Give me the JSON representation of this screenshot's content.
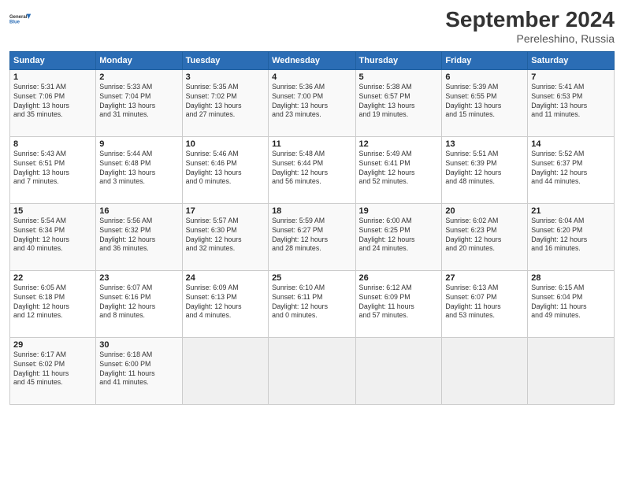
{
  "header": {
    "logo_line1": "General",
    "logo_line2": "Blue",
    "month": "September 2024",
    "location": "Pereleshino, Russia"
  },
  "weekdays": [
    "Sunday",
    "Monday",
    "Tuesday",
    "Wednesday",
    "Thursday",
    "Friday",
    "Saturday"
  ],
  "rows": [
    [
      {
        "day": "1",
        "info": "Sunrise: 5:31 AM\nSunset: 7:06 PM\nDaylight: 13 hours\nand 35 minutes."
      },
      {
        "day": "2",
        "info": "Sunrise: 5:33 AM\nSunset: 7:04 PM\nDaylight: 13 hours\nand 31 minutes."
      },
      {
        "day": "3",
        "info": "Sunrise: 5:35 AM\nSunset: 7:02 PM\nDaylight: 13 hours\nand 27 minutes."
      },
      {
        "day": "4",
        "info": "Sunrise: 5:36 AM\nSunset: 7:00 PM\nDaylight: 13 hours\nand 23 minutes."
      },
      {
        "day": "5",
        "info": "Sunrise: 5:38 AM\nSunset: 6:57 PM\nDaylight: 13 hours\nand 19 minutes."
      },
      {
        "day": "6",
        "info": "Sunrise: 5:39 AM\nSunset: 6:55 PM\nDaylight: 13 hours\nand 15 minutes."
      },
      {
        "day": "7",
        "info": "Sunrise: 5:41 AM\nSunset: 6:53 PM\nDaylight: 13 hours\nand 11 minutes."
      }
    ],
    [
      {
        "day": "8",
        "info": "Sunrise: 5:43 AM\nSunset: 6:51 PM\nDaylight: 13 hours\nand 7 minutes."
      },
      {
        "day": "9",
        "info": "Sunrise: 5:44 AM\nSunset: 6:48 PM\nDaylight: 13 hours\nand 3 minutes."
      },
      {
        "day": "10",
        "info": "Sunrise: 5:46 AM\nSunset: 6:46 PM\nDaylight: 13 hours\nand 0 minutes."
      },
      {
        "day": "11",
        "info": "Sunrise: 5:48 AM\nSunset: 6:44 PM\nDaylight: 12 hours\nand 56 minutes."
      },
      {
        "day": "12",
        "info": "Sunrise: 5:49 AM\nSunset: 6:41 PM\nDaylight: 12 hours\nand 52 minutes."
      },
      {
        "day": "13",
        "info": "Sunrise: 5:51 AM\nSunset: 6:39 PM\nDaylight: 12 hours\nand 48 minutes."
      },
      {
        "day": "14",
        "info": "Sunrise: 5:52 AM\nSunset: 6:37 PM\nDaylight: 12 hours\nand 44 minutes."
      }
    ],
    [
      {
        "day": "15",
        "info": "Sunrise: 5:54 AM\nSunset: 6:34 PM\nDaylight: 12 hours\nand 40 minutes."
      },
      {
        "day": "16",
        "info": "Sunrise: 5:56 AM\nSunset: 6:32 PM\nDaylight: 12 hours\nand 36 minutes."
      },
      {
        "day": "17",
        "info": "Sunrise: 5:57 AM\nSunset: 6:30 PM\nDaylight: 12 hours\nand 32 minutes."
      },
      {
        "day": "18",
        "info": "Sunrise: 5:59 AM\nSunset: 6:27 PM\nDaylight: 12 hours\nand 28 minutes."
      },
      {
        "day": "19",
        "info": "Sunrise: 6:00 AM\nSunset: 6:25 PM\nDaylight: 12 hours\nand 24 minutes."
      },
      {
        "day": "20",
        "info": "Sunrise: 6:02 AM\nSunset: 6:23 PM\nDaylight: 12 hours\nand 20 minutes."
      },
      {
        "day": "21",
        "info": "Sunrise: 6:04 AM\nSunset: 6:20 PM\nDaylight: 12 hours\nand 16 minutes."
      }
    ],
    [
      {
        "day": "22",
        "info": "Sunrise: 6:05 AM\nSunset: 6:18 PM\nDaylight: 12 hours\nand 12 minutes."
      },
      {
        "day": "23",
        "info": "Sunrise: 6:07 AM\nSunset: 6:16 PM\nDaylight: 12 hours\nand 8 minutes."
      },
      {
        "day": "24",
        "info": "Sunrise: 6:09 AM\nSunset: 6:13 PM\nDaylight: 12 hours\nand 4 minutes."
      },
      {
        "day": "25",
        "info": "Sunrise: 6:10 AM\nSunset: 6:11 PM\nDaylight: 12 hours\nand 0 minutes."
      },
      {
        "day": "26",
        "info": "Sunrise: 6:12 AM\nSunset: 6:09 PM\nDaylight: 11 hours\nand 57 minutes."
      },
      {
        "day": "27",
        "info": "Sunrise: 6:13 AM\nSunset: 6:07 PM\nDaylight: 11 hours\nand 53 minutes."
      },
      {
        "day": "28",
        "info": "Sunrise: 6:15 AM\nSunset: 6:04 PM\nDaylight: 11 hours\nand 49 minutes."
      }
    ],
    [
      {
        "day": "29",
        "info": "Sunrise: 6:17 AM\nSunset: 6:02 PM\nDaylight: 11 hours\nand 45 minutes."
      },
      {
        "day": "30",
        "info": "Sunrise: 6:18 AM\nSunset: 6:00 PM\nDaylight: 11 hours\nand 41 minutes."
      },
      {
        "day": "",
        "info": ""
      },
      {
        "day": "",
        "info": ""
      },
      {
        "day": "",
        "info": ""
      },
      {
        "day": "",
        "info": ""
      },
      {
        "day": "",
        "info": ""
      }
    ]
  ]
}
